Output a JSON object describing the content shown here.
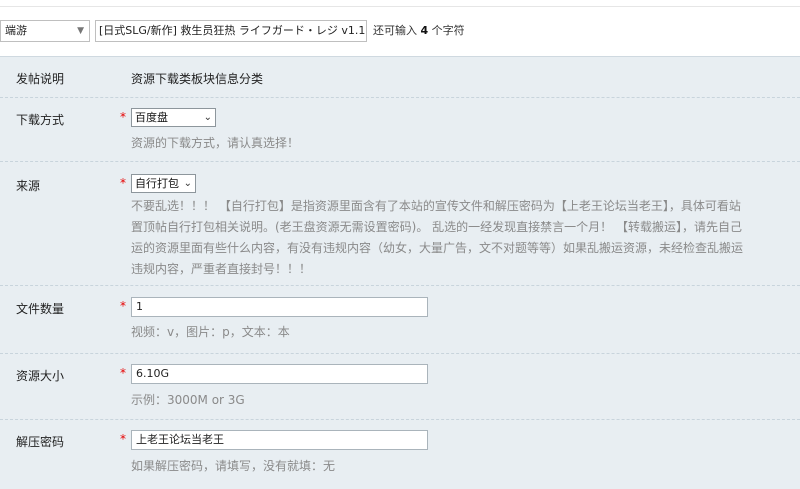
{
  "title_row": {
    "type_select": "端游",
    "title_value": "[日式SLG/新作] 救生员狂热 ライフガード・レジ v1.1 官中",
    "remain_prefix": "还可输入 ",
    "remain_count": "4",
    "remain_suffix": " 个字符"
  },
  "form": {
    "intro": {
      "label": "发帖说明",
      "value": "资源下载类板块信息分类"
    },
    "download": {
      "label": "下载方式",
      "required": "*",
      "selected": "百度盘",
      "hint": "资源的下载方式，请认真选择！"
    },
    "source": {
      "label": "来源",
      "required": "*",
      "selected": "自行打包",
      "hint_lines": [
        "不要乱选！！！ 【自行打包】是指资源里面含有了本站的宣传文件和解压密码为【上老王论坛当老王】，具体可看站",
        "置顶帖自行打包相关说明。(老王盘资源无需设置密码)。 乱选的一经发现直接禁言一个月！ 【转载搬运】，请先自己",
        "运的资源里面有些什么内容，有没有违规内容（幼女，大量广告，文不对题等等）如果乱搬运资源，未经检查乱搬运",
        "违规内容，严重者直接封号！！！"
      ]
    },
    "file_count": {
      "label": "文件数量",
      "required": "*",
      "value": "1",
      "hint": "视频：v，图片：p，文本：本"
    },
    "size": {
      "label": "资源大小",
      "required": "*",
      "value": "6.10G",
      "hint": "示例：3000M or 3G"
    },
    "password": {
      "label": "解压密码",
      "required": "*",
      "value": "上老王论坛当老王",
      "hint": "如果解压密码，请填写，没有就填：无"
    }
  }
}
